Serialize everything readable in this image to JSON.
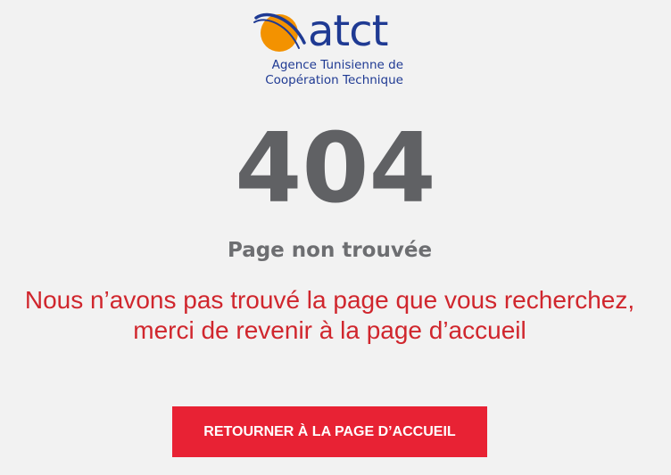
{
  "logo": {
    "wordmark": "atct",
    "subtitle_line1": "Agence Tunisienne de",
    "subtitle_line2": "Coopération Technique",
    "icon": "orbit-globe-icon",
    "colors": {
      "orange": "#f39200",
      "blue": "#1f3a93"
    }
  },
  "error": {
    "code": "404",
    "title": "Page non trouvée",
    "message_line1": "Nous n’avons pas trouvé la page que vous recherchez,",
    "message_line2": "merci de revenir à la page d’accueil"
  },
  "home_button": {
    "label": "RETOURNER À LA PAGE D’ACCUEIL"
  },
  "colors": {
    "background": "#f2f2f2",
    "code": "#606164",
    "title": "#6d6e71",
    "message": "#d0262d",
    "button": "#e82234"
  }
}
